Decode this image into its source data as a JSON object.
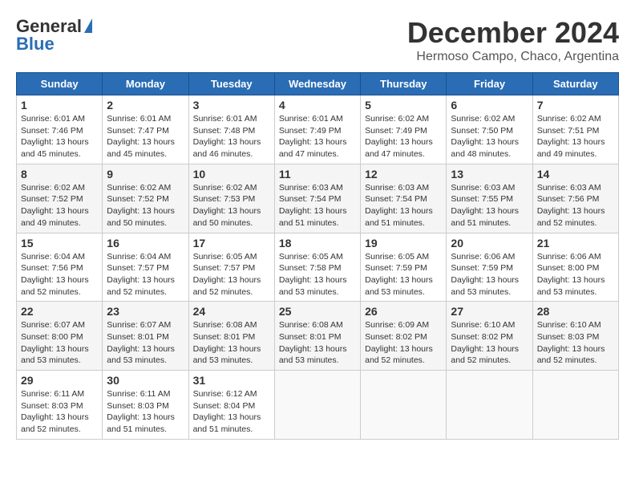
{
  "header": {
    "logo_line1": "General",
    "logo_line2": "Blue",
    "title": "December 2024",
    "subtitle": "Hermoso Campo, Chaco, Argentina"
  },
  "columns": [
    "Sunday",
    "Monday",
    "Tuesday",
    "Wednesday",
    "Thursday",
    "Friday",
    "Saturday"
  ],
  "weeks": [
    [
      {
        "day": "1",
        "sunrise": "6:01 AM",
        "sunset": "7:46 PM",
        "daylight": "13 hours and 45 minutes."
      },
      {
        "day": "2",
        "sunrise": "6:01 AM",
        "sunset": "7:47 PM",
        "daylight": "13 hours and 45 minutes."
      },
      {
        "day": "3",
        "sunrise": "6:01 AM",
        "sunset": "7:48 PM",
        "daylight": "13 hours and 46 minutes."
      },
      {
        "day": "4",
        "sunrise": "6:01 AM",
        "sunset": "7:49 PM",
        "daylight": "13 hours and 47 minutes."
      },
      {
        "day": "5",
        "sunrise": "6:02 AM",
        "sunset": "7:49 PM",
        "daylight": "13 hours and 47 minutes."
      },
      {
        "day": "6",
        "sunrise": "6:02 AM",
        "sunset": "7:50 PM",
        "daylight": "13 hours and 48 minutes."
      },
      {
        "day": "7",
        "sunrise": "6:02 AM",
        "sunset": "7:51 PM",
        "daylight": "13 hours and 49 minutes."
      }
    ],
    [
      {
        "day": "8",
        "sunrise": "6:02 AM",
        "sunset": "7:52 PM",
        "daylight": "13 hours and 49 minutes."
      },
      {
        "day": "9",
        "sunrise": "6:02 AM",
        "sunset": "7:52 PM",
        "daylight": "13 hours and 50 minutes."
      },
      {
        "day": "10",
        "sunrise": "6:02 AM",
        "sunset": "7:53 PM",
        "daylight": "13 hours and 50 minutes."
      },
      {
        "day": "11",
        "sunrise": "6:03 AM",
        "sunset": "7:54 PM",
        "daylight": "13 hours and 51 minutes."
      },
      {
        "day": "12",
        "sunrise": "6:03 AM",
        "sunset": "7:54 PM",
        "daylight": "13 hours and 51 minutes."
      },
      {
        "day": "13",
        "sunrise": "6:03 AM",
        "sunset": "7:55 PM",
        "daylight": "13 hours and 51 minutes."
      },
      {
        "day": "14",
        "sunrise": "6:03 AM",
        "sunset": "7:56 PM",
        "daylight": "13 hours and 52 minutes."
      }
    ],
    [
      {
        "day": "15",
        "sunrise": "6:04 AM",
        "sunset": "7:56 PM",
        "daylight": "13 hours and 52 minutes."
      },
      {
        "day": "16",
        "sunrise": "6:04 AM",
        "sunset": "7:57 PM",
        "daylight": "13 hours and 52 minutes."
      },
      {
        "day": "17",
        "sunrise": "6:05 AM",
        "sunset": "7:57 PM",
        "daylight": "13 hours and 52 minutes."
      },
      {
        "day": "18",
        "sunrise": "6:05 AM",
        "sunset": "7:58 PM",
        "daylight": "13 hours and 53 minutes."
      },
      {
        "day": "19",
        "sunrise": "6:05 AM",
        "sunset": "7:59 PM",
        "daylight": "13 hours and 53 minutes."
      },
      {
        "day": "20",
        "sunrise": "6:06 AM",
        "sunset": "7:59 PM",
        "daylight": "13 hours and 53 minutes."
      },
      {
        "day": "21",
        "sunrise": "6:06 AM",
        "sunset": "8:00 PM",
        "daylight": "13 hours and 53 minutes."
      }
    ],
    [
      {
        "day": "22",
        "sunrise": "6:07 AM",
        "sunset": "8:00 PM",
        "daylight": "13 hours and 53 minutes."
      },
      {
        "day": "23",
        "sunrise": "6:07 AM",
        "sunset": "8:01 PM",
        "daylight": "13 hours and 53 minutes."
      },
      {
        "day": "24",
        "sunrise": "6:08 AM",
        "sunset": "8:01 PM",
        "daylight": "13 hours and 53 minutes."
      },
      {
        "day": "25",
        "sunrise": "6:08 AM",
        "sunset": "8:01 PM",
        "daylight": "13 hours and 53 minutes."
      },
      {
        "day": "26",
        "sunrise": "6:09 AM",
        "sunset": "8:02 PM",
        "daylight": "13 hours and 52 minutes."
      },
      {
        "day": "27",
        "sunrise": "6:10 AM",
        "sunset": "8:02 PM",
        "daylight": "13 hours and 52 minutes."
      },
      {
        "day": "28",
        "sunrise": "6:10 AM",
        "sunset": "8:03 PM",
        "daylight": "13 hours and 52 minutes."
      }
    ],
    [
      {
        "day": "29",
        "sunrise": "6:11 AM",
        "sunset": "8:03 PM",
        "daylight": "13 hours and 52 minutes."
      },
      {
        "day": "30",
        "sunrise": "6:11 AM",
        "sunset": "8:03 PM",
        "daylight": "13 hours and 51 minutes."
      },
      {
        "day": "31",
        "sunrise": "6:12 AM",
        "sunset": "8:04 PM",
        "daylight": "13 hours and 51 minutes."
      },
      null,
      null,
      null,
      null
    ]
  ]
}
